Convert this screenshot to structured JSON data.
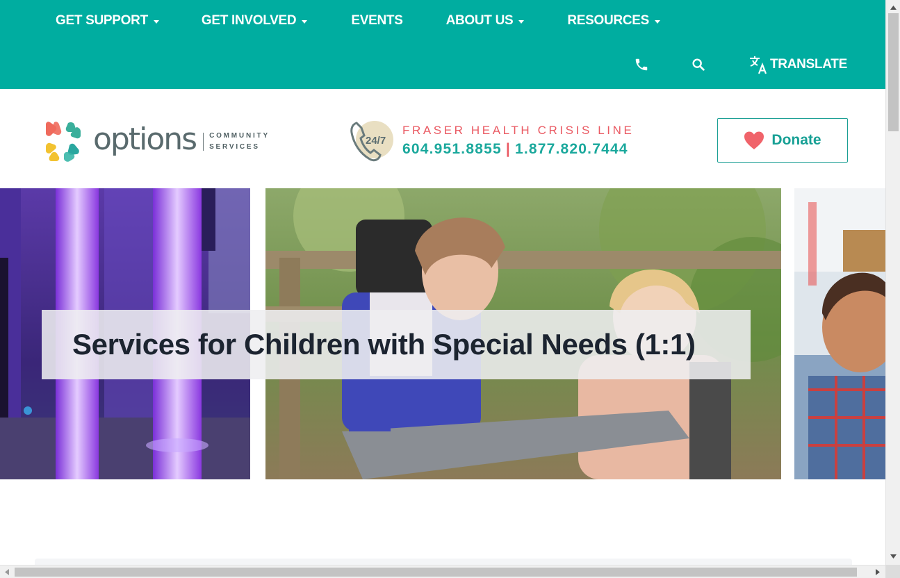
{
  "nav": {
    "items": [
      {
        "label": "GET SUPPORT",
        "has_dropdown": true
      },
      {
        "label": "GET INVOLVED",
        "has_dropdown": true
      },
      {
        "label": "EVENTS",
        "has_dropdown": false
      },
      {
        "label": "ABOUT US",
        "has_dropdown": true
      },
      {
        "label": "RESOURCES",
        "has_dropdown": true
      }
    ],
    "utility": {
      "phone_icon": "phone-icon",
      "search_icon": "search-icon",
      "translate_icon": "translate-icon",
      "translate_label": "TRANSLATE"
    }
  },
  "header": {
    "logo": {
      "wordmark": "options",
      "subtitle_line1": "COMMUNITY",
      "subtitle_line2": "SERVICES"
    },
    "crisis": {
      "badge": "24/7",
      "title": "FRASER HEALTH CRISIS LINE",
      "phone_local": "604.951.8855",
      "separator": "|",
      "phone_tollfree": "1.877.820.7444"
    },
    "donate": {
      "label": "Donate",
      "icon": "heart-icon"
    }
  },
  "hero": {
    "title": "Services for Children with Special Needs (1:1)"
  },
  "colors": {
    "brand_teal": "#00ada0",
    "crisis_red": "#ea5a63",
    "donate_heart": "#f0636a",
    "text_dark": "#1c2430"
  }
}
